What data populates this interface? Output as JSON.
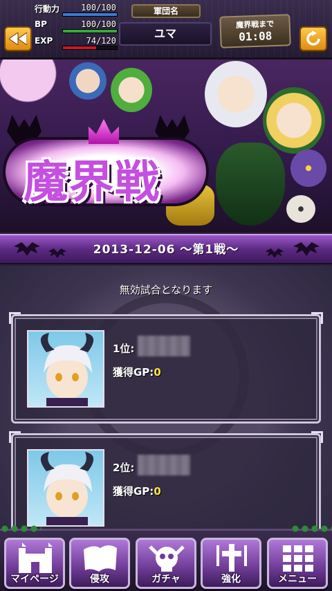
{
  "header": {
    "stats": [
      {
        "label": "行動力",
        "value": "100/100",
        "fill": 1.0,
        "color": "#3a7cd8"
      },
      {
        "label": "BP",
        "value": "100/100",
        "fill": 1.0,
        "color": "#3aa83a"
      },
      {
        "label": "EXP",
        "value": "74/120",
        "fill": 0.62,
        "color": "#c8182a"
      }
    ],
    "group_label": "軍団名",
    "group_name": "ユマ",
    "timer_label": "魔界戦まで",
    "timer_value": "01:08"
  },
  "banner": {
    "title": "魔界戦"
  },
  "ribbon": {
    "date_text": "2013-12-06 〜第1戦〜"
  },
  "main": {
    "status_message": "無効試合となります",
    "ranks": [
      {
        "rank_label": "1位:",
        "gp_label": "獲得GP:",
        "gp_value": "0"
      },
      {
        "rank_label": "2位:",
        "gp_label": "獲得GP:",
        "gp_value": "0"
      }
    ]
  },
  "nav": {
    "items": [
      {
        "label": "マイページ",
        "icon": "castle-icon"
      },
      {
        "label": "侵攻",
        "icon": "map-icon"
      },
      {
        "label": "ガチャ",
        "icon": "skull-icon"
      },
      {
        "label": "強化",
        "icon": "cross-icon"
      },
      {
        "label": "メニュー",
        "icon": "menu-grid-icon"
      }
    ]
  }
}
